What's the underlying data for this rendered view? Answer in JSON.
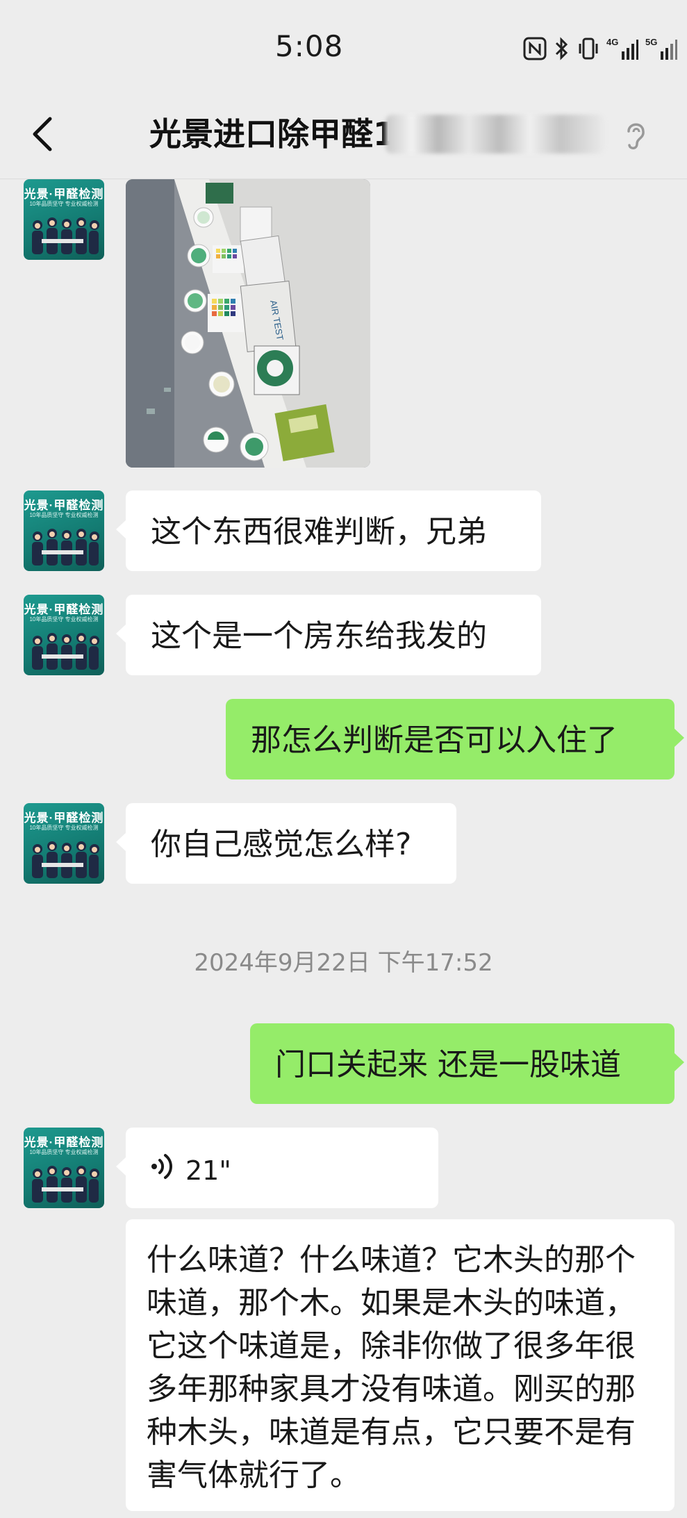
{
  "status_bar": {
    "time": "5:08",
    "network_1": "4G",
    "network_2": "5G"
  },
  "header": {
    "title": "光景进口除甲醛1",
    "back_icon": "chevron-left-icon",
    "mode_icon": "ear-icon"
  },
  "contact_avatar": {
    "line1": "光景·甲醛检测",
    "line2": "10年品质坚守 专业权威检测"
  },
  "messages": [
    {
      "side": "in",
      "type": "image",
      "alt_text": "AIR TEST"
    },
    {
      "side": "in",
      "type": "text",
      "text": "这个东西很难判断，兄弟"
    },
    {
      "side": "in",
      "type": "text",
      "text": "这个是一个房东给我发的"
    },
    {
      "side": "out",
      "type": "text",
      "text": "那怎么判断是否可以入住了"
    },
    {
      "side": "in",
      "type": "text",
      "text": "你自己感觉怎么样?"
    },
    {
      "type": "timestamp",
      "text": "2024年9月22日 下午17:52"
    },
    {
      "side": "out",
      "type": "text",
      "text": "门口关起来 还是一股味道"
    },
    {
      "side": "in",
      "type": "voice",
      "duration": "21\""
    },
    {
      "side": "in",
      "type": "transcript",
      "text": "什么味道？什么味道？它木头的那个味道，那个木。如果是木头的味道，它这个味道是，除非你做了很多年很多年那种家具才没有味道。刚买的那种木头，味道是有点，它只要不是有害气体就行了。"
    }
  ],
  "colors": {
    "background": "#ededed",
    "incoming_bubble": "#ffffff",
    "outgoing_bubble": "#95ec69",
    "timestamp_text": "#8a8a8a"
  }
}
